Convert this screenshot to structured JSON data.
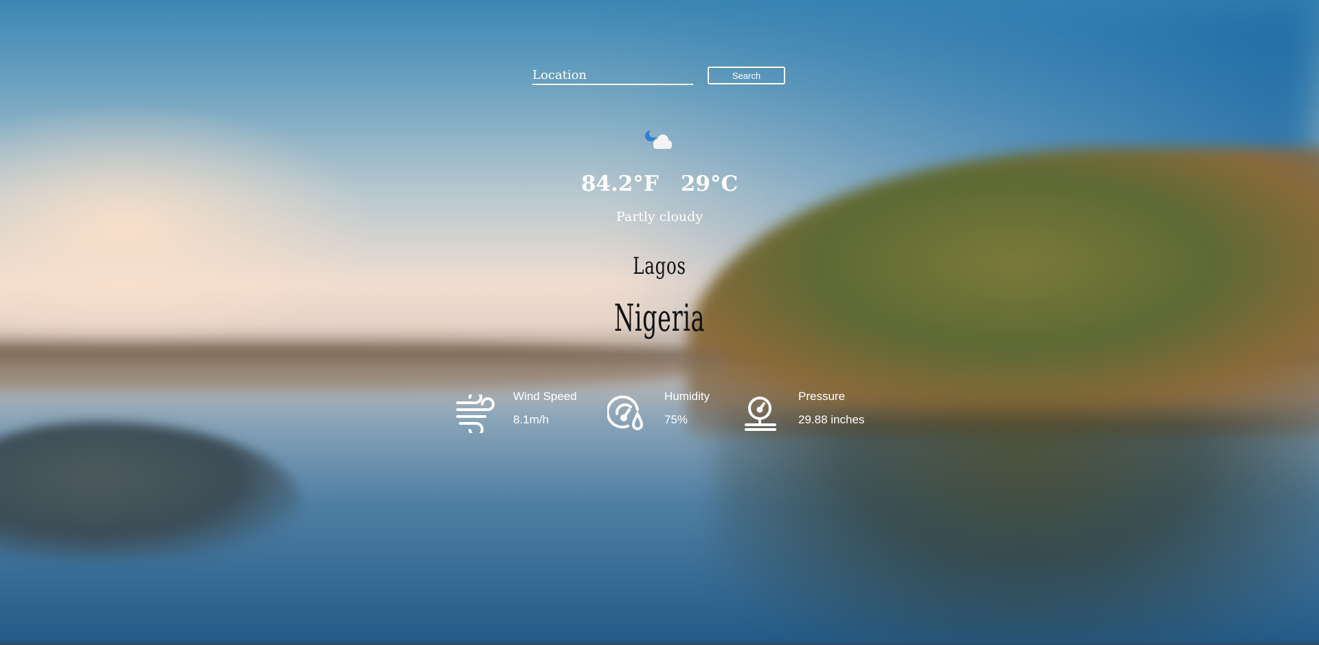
{
  "search": {
    "placeholder": "Location",
    "button_label": "Search"
  },
  "current": {
    "condition_icon": "partly-cloudy-night-icon",
    "temp_f": "84.2°F",
    "temp_c": "29°C",
    "condition": "Partly cloudy"
  },
  "location": {
    "city": "Lagos",
    "country": "Nigeria"
  },
  "stats": {
    "wind": {
      "label": "Wind Speed",
      "value": "8.1m/h",
      "icon": "wind-icon"
    },
    "humidity": {
      "label": "Humidity",
      "value": "75%",
      "icon": "humidity-icon"
    },
    "pressure": {
      "label": "Pressure",
      "value": "29.88 inches",
      "icon": "barometer-icon"
    }
  },
  "colors": {
    "text": "#ffffff",
    "location_text": "#111111",
    "moon": "#2f7fd6"
  }
}
